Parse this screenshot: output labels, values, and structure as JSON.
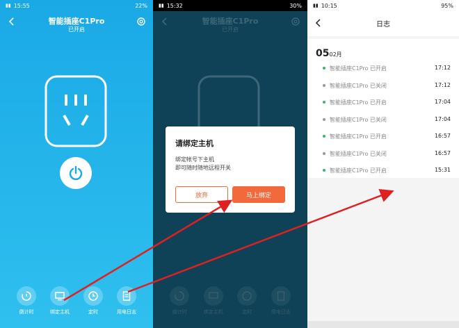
{
  "screen1": {
    "status": {
      "time": "15:55",
      "right": "22%"
    },
    "title": "智能插座C1Pro",
    "subtitle": "已开启",
    "bottom": [
      {
        "label": "倒计时",
        "icon": "countdown-icon"
      },
      {
        "label": "绑定主机",
        "icon": "monitor-icon"
      },
      {
        "label": "定时",
        "icon": "clock-icon"
      },
      {
        "label": "用电日志",
        "icon": "log-icon"
      }
    ]
  },
  "screen2": {
    "status": {
      "time": "15:32",
      "right": "30%"
    },
    "title": "智能插座C1Pro",
    "subtitle": "已开启",
    "dialog": {
      "title": "请绑定主机",
      "line1": "绑定帐号下主机",
      "line2": "即可随时随地远程开关",
      "cancel": "放弃",
      "confirm": "马上绑定"
    },
    "bottom": [
      {
        "label": "倒计时"
      },
      {
        "label": "绑定主机"
      },
      {
        "label": "定时"
      },
      {
        "label": "用电日志"
      }
    ]
  },
  "screen3": {
    "status": {
      "time": "10:15",
      "right": "95%"
    },
    "title": "日志",
    "date": {
      "day": "05",
      "month": "02月"
    },
    "logs": [
      {
        "text": "智能插座C1Pro 已开启",
        "time": "17:12",
        "state": "on"
      },
      {
        "text": "智能插座C1Pro 已关闭",
        "time": "17:12",
        "state": "off"
      },
      {
        "text": "智能插座C1Pro 已开启",
        "time": "17:04",
        "state": "on"
      },
      {
        "text": "智能插座C1Pro 已关闭",
        "time": "17:04",
        "state": "off"
      },
      {
        "text": "智能插座C1Pro 已开启",
        "time": "16:57",
        "state": "on"
      },
      {
        "text": "智能插座C1Pro 已关闭",
        "time": "16:57",
        "state": "off"
      },
      {
        "text": "智能插座C1Pro 已开启",
        "time": "15:31",
        "state": "on"
      }
    ]
  },
  "colors": {
    "accent": "#f26a3b",
    "on": "#3cb371",
    "off": "#999999",
    "arrow": "#e02020"
  }
}
